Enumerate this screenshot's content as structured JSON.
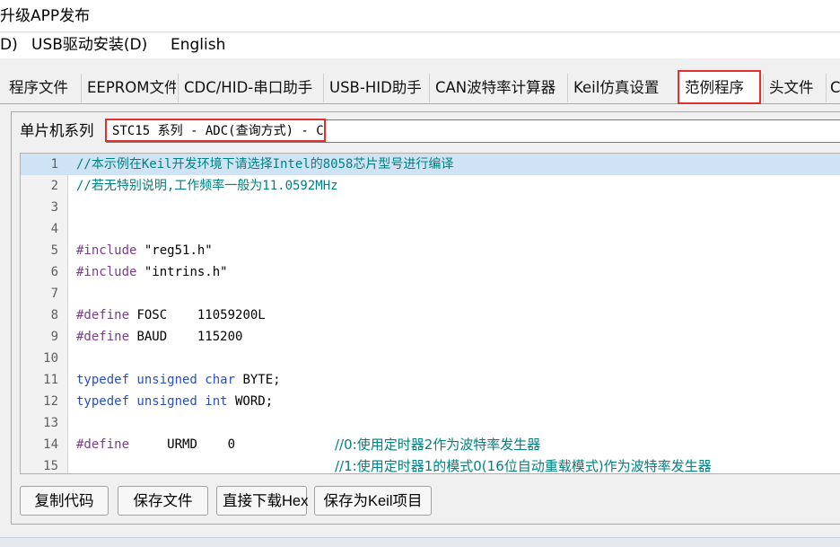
{
  "window": {
    "title": "升级APP发布"
  },
  "menu": [
    {
      "label": "D)"
    },
    {
      "label": "USB驱动安装(D)"
    },
    {
      "label": "English"
    }
  ],
  "tabs": [
    {
      "label": "程序文件"
    },
    {
      "label": "EEPROM文件"
    },
    {
      "label": "CDC/HID-串口助手"
    },
    {
      "label": "USB-HID助手"
    },
    {
      "label": "CAN波特率计算器"
    },
    {
      "label": "Keil仿真设置"
    },
    {
      "label": "范例程序",
      "active": true
    },
    {
      "label": "头文件"
    },
    {
      "label": "C"
    }
  ],
  "series": {
    "label": "单片机系列",
    "selected": "STC15 系列 - ADC(查询方式) - C"
  },
  "editor": {
    "lines": [
      {
        "n": "1",
        "segs": [
          {
            "t": "//本示例在Keil开发环境下请选择Intel的8058芯片型号进行编译",
            "c": "c-comment"
          }
        ]
      },
      {
        "n": "2",
        "segs": [
          {
            "t": "//若无特别说明,工作频率一般为11.0592MHz",
            "c": "c-comment"
          }
        ]
      },
      {
        "n": "3",
        "segs": []
      },
      {
        "n": "4",
        "segs": []
      },
      {
        "n": "5",
        "segs": [
          {
            "t": "#include",
            "c": "c-pp"
          },
          {
            "t": " \"reg51.h\"",
            "c": "c-txt"
          }
        ]
      },
      {
        "n": "6",
        "segs": [
          {
            "t": "#include",
            "c": "c-pp"
          },
          {
            "t": " \"intrins.h\"",
            "c": "c-txt"
          }
        ]
      },
      {
        "n": "7",
        "segs": []
      },
      {
        "n": "8",
        "segs": [
          {
            "t": "#define",
            "c": "c-pp"
          },
          {
            "t": " FOSC    11059200L",
            "c": "c-txt"
          }
        ]
      },
      {
        "n": "9",
        "segs": [
          {
            "t": "#define",
            "c": "c-pp"
          },
          {
            "t": " BAUD    115200",
            "c": "c-txt"
          }
        ]
      },
      {
        "n": "10",
        "segs": []
      },
      {
        "n": "11",
        "segs": [
          {
            "t": "typedef unsigned char",
            "c": "c-kw"
          },
          {
            "t": " BYTE;",
            "c": "c-txt"
          }
        ]
      },
      {
        "n": "12",
        "segs": [
          {
            "t": "typedef unsigned int",
            "c": "c-kw"
          },
          {
            "t": " WORD;",
            "c": "c-txt"
          }
        ]
      },
      {
        "n": "13",
        "segs": []
      },
      {
        "n": "14",
        "segs": [
          {
            "t": "#define",
            "c": "c-pp"
          },
          {
            "t": "     URMD    0",
            "c": "c-txt"
          }
        ],
        "comment": "//0:使用定时器2作为波特率发生器"
      },
      {
        "n": "15",
        "segs": [],
        "comment": "//1:使用定时器1的模式0(16位自动重载模式)作为波特率发生器"
      }
    ]
  },
  "buttons": {
    "copy": "复制代码",
    "save_file": "保存文件",
    "download_hex": "直接下载Hex",
    "save_keil": "保存为Keil项目"
  },
  "colors": {
    "highlight_border": "#e03030",
    "current_line": "#cfe3f5",
    "comment": "#008080",
    "preprocessor": "#7a3c8c",
    "keyword": "#2a4fc0"
  }
}
